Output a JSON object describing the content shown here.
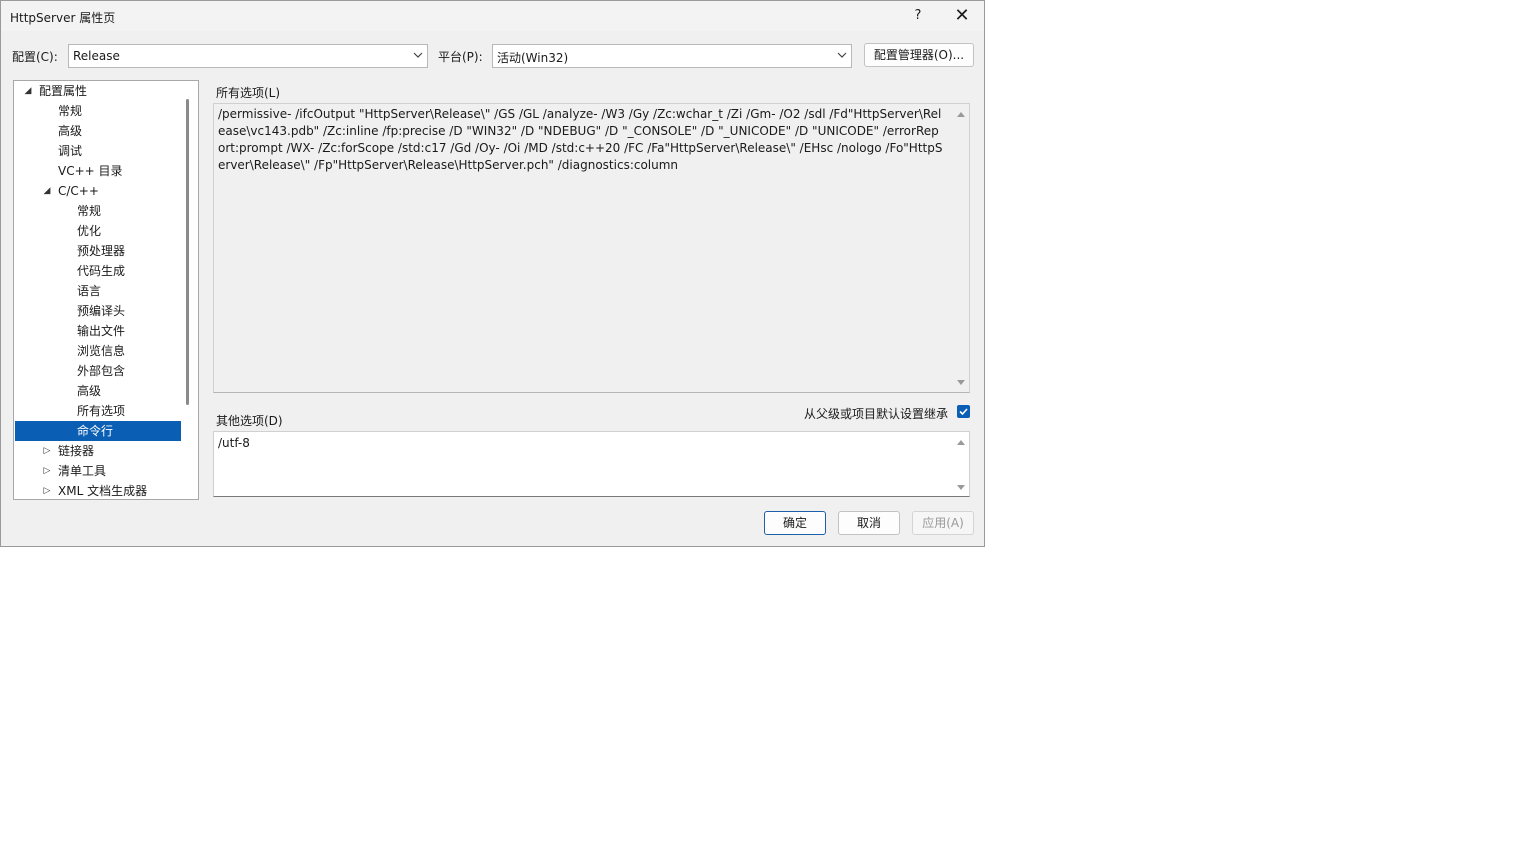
{
  "window": {
    "title": "HttpServer 属性页",
    "help_glyph": "?",
    "close_glyph": "✕"
  },
  "config": {
    "config_label": "配置(C):",
    "config_value": "Release",
    "platform_label": "平台(P):",
    "platform_value": "活动(Win32)",
    "manager_button": "配置管理器(O)..."
  },
  "tree": {
    "items": [
      {
        "label": "配置属性",
        "expander": "◢"
      },
      {
        "label": "常规"
      },
      {
        "label": "高级"
      },
      {
        "label": "调试"
      },
      {
        "label": "VC++ 目录"
      },
      {
        "label": "C/C++",
        "expander": "◢"
      },
      {
        "label": "常规"
      },
      {
        "label": "优化"
      },
      {
        "label": "预处理器"
      },
      {
        "label": "代码生成"
      },
      {
        "label": "语言"
      },
      {
        "label": "预编译头"
      },
      {
        "label": "输出文件"
      },
      {
        "label": "浏览信息"
      },
      {
        "label": "外部包含"
      },
      {
        "label": "高级"
      },
      {
        "label": "所有选项"
      },
      {
        "label": "命令行",
        "selected": true
      },
      {
        "label": "链接器",
        "expander": "▷"
      },
      {
        "label": "清单工具",
        "expander": "▷"
      },
      {
        "label": "XML 文档生成器",
        "expander": "▷"
      }
    ]
  },
  "all_options": {
    "label": "所有选项(L)",
    "text": "/permissive- /ifcOutput \"HttpServer\\Release\\\" /GS /GL /analyze- /W3 /Gy /Zc:wchar_t /Zi /Gm- /O2 /sdl /Fd\"HttpServer\\Release\\vc143.pdb\" /Zc:inline /fp:precise /D \"WIN32\" /D \"NDEBUG\" /D \"_CONSOLE\" /D \"_UNICODE\" /D \"UNICODE\" /errorReport:prompt /WX- /Zc:forScope /std:c17 /Gd /Oy- /Oi /MD /std:c++20 /FC /Fa\"HttpServer\\Release\\\" /EHsc /nologo /Fo\"HttpServer\\Release\\\" /Fp\"HttpServer\\Release\\HttpServer.pch\" /diagnostics:column"
  },
  "other_options": {
    "label": "其他选项(D)",
    "value": "/utf-8",
    "inherit_label": "从父级或项目默认设置继承",
    "inherit_checked": true
  },
  "buttons": {
    "ok": "确定",
    "cancel": "取消",
    "apply": "应用(A)"
  },
  "colors": {
    "accent": "#0a5fb4",
    "dialog_bg": "#f0f0f0"
  }
}
